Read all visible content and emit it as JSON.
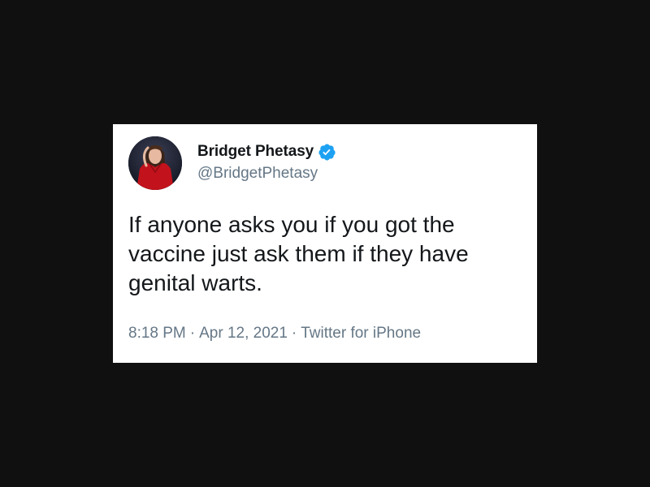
{
  "tweet": {
    "author": {
      "display_name": "Bridget Phetasy",
      "handle": "@BridgetPhetasy",
      "verified": true,
      "avatar": "profile-photo"
    },
    "text": "If anyone asks you if you got the\nvaccine just ask them if they have\ngenital warts.",
    "time": "8:18 PM",
    "date": "Apr 12, 2021",
    "source": "Twitter for iPhone",
    "separator": "·"
  },
  "colors": {
    "background": "#101010",
    "card": "#ffffff",
    "text": "#14171a",
    "muted": "#657786",
    "verified": "#1da1f2"
  }
}
